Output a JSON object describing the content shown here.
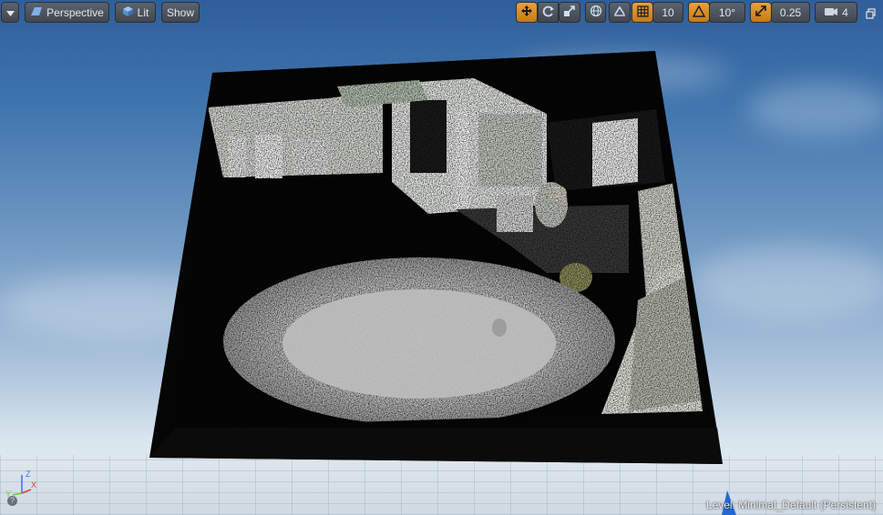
{
  "toolbar": {
    "dropdown_icon": "chevron-down-icon",
    "perspective_label": "Perspective",
    "lit_label": "Lit",
    "show_label": "Show",
    "grid_snap_value": "10",
    "rotation_snap_value": "10°",
    "scale_snap_value": "0.25",
    "camera_speed_value": "4"
  },
  "status": {
    "level_label": "Level:",
    "level_name": "Minimal_Default (Persistent)"
  },
  "axis_gizmo": {
    "x": "X",
    "y": "Y",
    "z": "Z"
  },
  "colors": {
    "accent": "#e39a35",
    "axis_x": "#e23a3a",
    "axis_y": "#5fcf3a",
    "axis_z": "#3a72e2"
  }
}
